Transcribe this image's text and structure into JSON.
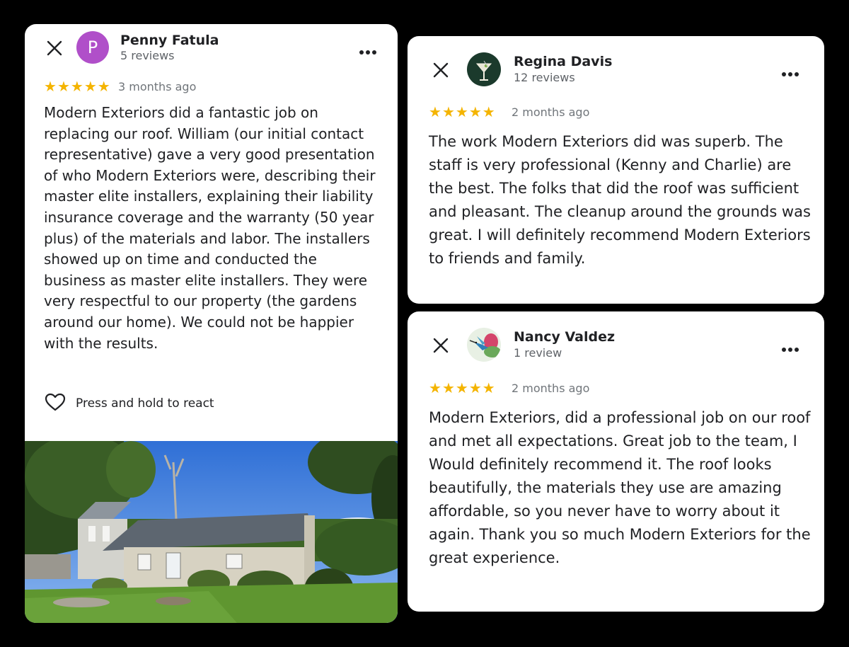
{
  "reviews": [
    {
      "avatar_letter": "P",
      "avatar_color": "#b04fc9",
      "name": "Penny Fatula",
      "review_count": "5 reviews",
      "stars": 5,
      "time": "3 months ago",
      "text": "Modern Exteriors did a fantastic job on replacing our roof. William (our initial contact representative) gave a very good presentation of who Modern Exteriors were, describing their master elite installers, explaining their liability insurance coverage and the warranty (50 year plus) of the materials and labor. The installers showed up on time and conducted the business as master elite installers. They were very respectful to our property (the gardens around our home). We could not be happier with the results.",
      "react_label": "Press and hold to react",
      "photo": "house-photo"
    },
    {
      "avatar_icon": "martini-glass-icon",
      "name": "Regina Davis",
      "review_count": "12 reviews",
      "stars": 5,
      "time": "2 months ago",
      "text": "The work Modern Exteriors did was superb. The staff is very professional (Kenny and Charlie) are the best. The folks that did the roof was sufficient and pleasant. The cleanup around the grounds was great. I will definitely recommend Modern Exteriors to friends and family."
    },
    {
      "avatar_icon": "hummingbird-icon",
      "name": "Nancy Valdez",
      "review_count": "1 review",
      "stars": 5,
      "time": "2 months ago",
      "text": "Modern Exteriors, did a professional job on our roof and met all expectations. Great job to the team, I Would definitely recommend it. The roof looks beautifully, the materials they use are amazing affordable, so you never have to worry about it again. Thank you so much Modern Exteriors for the great experience."
    }
  ],
  "star_color": "#f4b400"
}
